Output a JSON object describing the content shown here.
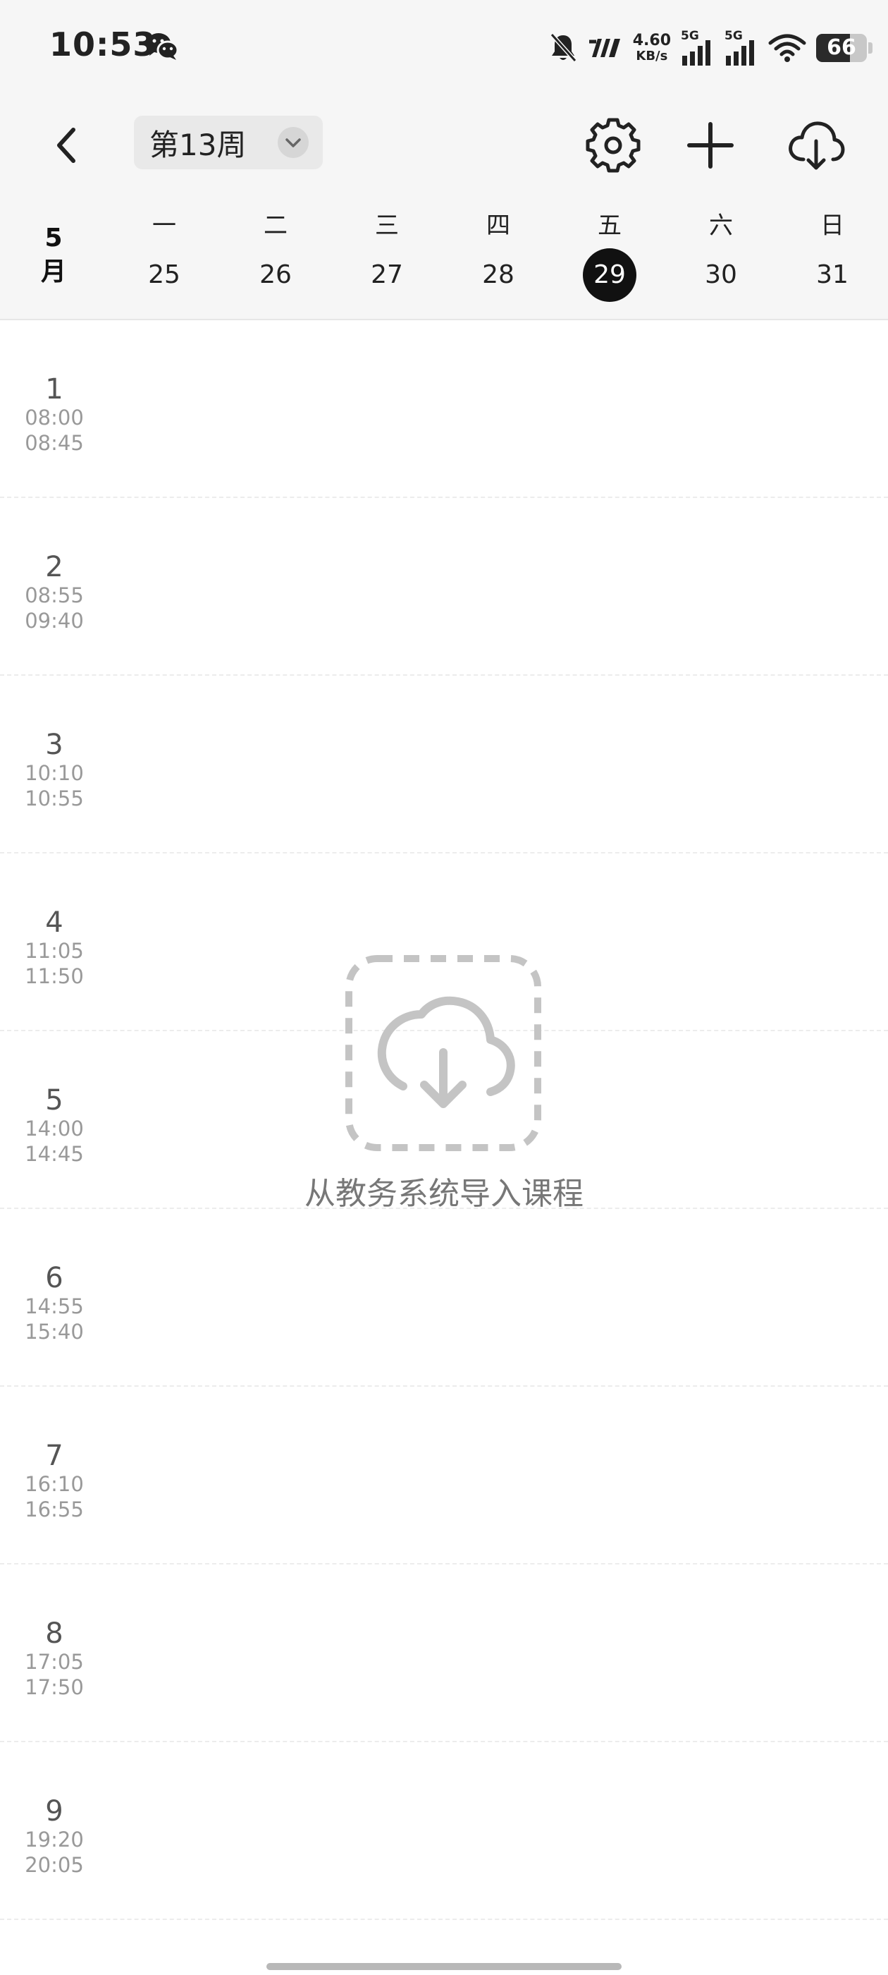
{
  "status_bar": {
    "time": "10:53",
    "net_speed_value": "4.60",
    "net_speed_unit": "KB/s",
    "sim1_label": "5G",
    "sim2_label": "5G",
    "battery": "66",
    "battery_level_percent": 66,
    "icons": [
      "wechat-icon",
      "bell-off-icon",
      "hd-icon",
      "signal-icon",
      "wifi-icon",
      "battery-icon"
    ]
  },
  "header": {
    "week_label": "第13周",
    "icons": [
      "back-icon",
      "chevron-down-icon",
      "gear-icon",
      "plus-icon",
      "cloud-download-icon"
    ]
  },
  "week": {
    "month": "5月",
    "days": [
      {
        "weekday": "一",
        "date": "25",
        "today": false
      },
      {
        "weekday": "二",
        "date": "26",
        "today": false
      },
      {
        "weekday": "三",
        "date": "27",
        "today": false
      },
      {
        "weekday": "四",
        "date": "28",
        "today": false
      },
      {
        "weekday": "五",
        "date": "29",
        "today": true
      },
      {
        "weekday": "六",
        "date": "30",
        "today": false
      },
      {
        "weekday": "日",
        "date": "31",
        "today": false
      }
    ]
  },
  "periods": [
    {
      "num": "1",
      "start": "08:00",
      "end": "08:45"
    },
    {
      "num": "2",
      "start": "08:55",
      "end": "09:40"
    },
    {
      "num": "3",
      "start": "10:10",
      "end": "10:55"
    },
    {
      "num": "4",
      "start": "11:05",
      "end": "11:50"
    },
    {
      "num": "5",
      "start": "14:00",
      "end": "14:45"
    },
    {
      "num": "6",
      "start": "14:55",
      "end": "15:40"
    },
    {
      "num": "7",
      "start": "16:10",
      "end": "16:55"
    },
    {
      "num": "8",
      "start": "17:05",
      "end": "17:50"
    },
    {
      "num": "9",
      "start": "19:20",
      "end": "20:05"
    }
  ],
  "empty_state": {
    "text": "从教务系统导入课程",
    "icon": "cloud-download-icon"
  },
  "colors": {
    "today_bg": "#111111",
    "header_bg": "#f6f6f6",
    "empty_icon": "#c4c4c4"
  }
}
